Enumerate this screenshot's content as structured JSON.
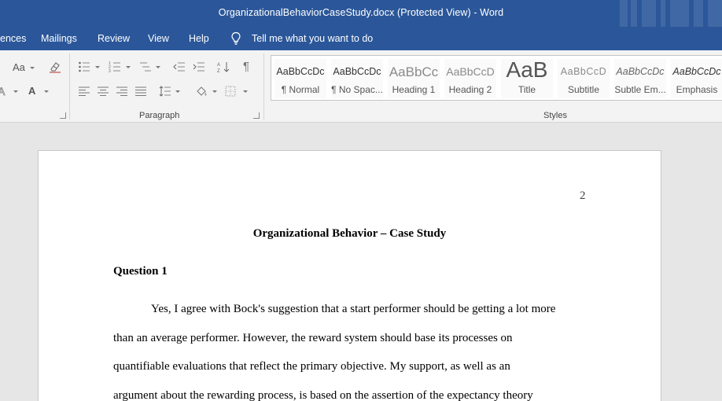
{
  "window": {
    "title": "OrganizationalBehaviorCaseStudy.docx (Protected View)  -  Word"
  },
  "tabs": [
    {
      "label": "ences"
    },
    {
      "label": "Mailings"
    },
    {
      "label": "Review"
    },
    {
      "label": "View"
    },
    {
      "label": "Help"
    }
  ],
  "tellme": {
    "label": "Tell me what you want to do",
    "icon": "lightbulb-icon"
  },
  "ribbon": {
    "font_group": {
      "change_case": "Aa",
      "font_color": "A"
    },
    "paragraph_label": "Paragraph",
    "styles_label": "Styles",
    "styles": [
      {
        "sample": "AaBbCcDc",
        "name": "¶ Normal"
      },
      {
        "sample": "AaBbCcDc",
        "name": "¶ No Spac..."
      },
      {
        "sample": "AaBbCc",
        "name": "Heading 1"
      },
      {
        "sample": "AaBbCcD",
        "name": "Heading 2"
      },
      {
        "sample": "AaB",
        "name": "Title"
      },
      {
        "sample": "AaBbCcD",
        "name": "Subtitle"
      },
      {
        "sample": "AaBbCcDc",
        "name": "Subtle Em..."
      },
      {
        "sample": "AaBbCcDc",
        "name": "Emphasis"
      }
    ]
  },
  "document": {
    "page_number": "2",
    "title": "Organizational Behavior – Case Study",
    "heading": "Question 1",
    "lines": [
      "Yes, I agree with Bock's suggestion that a start performer should be getting a lot more",
      "than an average performer. However, the reward system should base its processes on",
      "quantifiable evaluations that reflect the primary objective. My support, as well as an",
      "argument about the rewarding process, is based on the assertion of the expectancy theory"
    ]
  },
  "colors": {
    "titlebar": "#2b579a",
    "ribbon": "#f3f3f3",
    "canvas": "#e6e6e6",
    "page": "#ffffff"
  }
}
